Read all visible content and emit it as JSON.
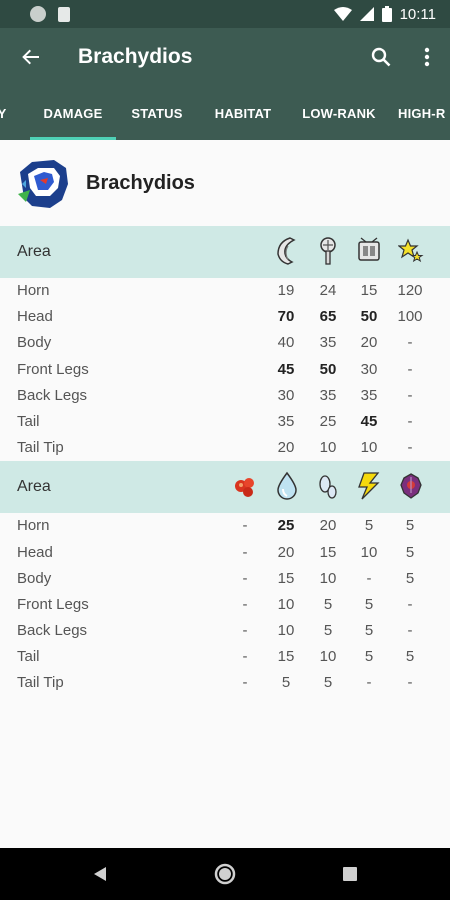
{
  "status_bar": {
    "time": "10:11"
  },
  "app_bar": {
    "title": "Brachydios"
  },
  "tabs": [
    {
      "label": "Y",
      "active": false
    },
    {
      "label": "DAMAGE",
      "active": true
    },
    {
      "label": "STATUS",
      "active": false
    },
    {
      "label": "HABITAT",
      "active": false
    },
    {
      "label": "LOW-RANK",
      "active": false
    },
    {
      "label": "HIGH-R",
      "active": false
    }
  ],
  "monster": {
    "name": "Brachydios"
  },
  "physical": {
    "header": "Area",
    "icons": [
      "sever-icon",
      "blunt-icon",
      "shot-icon",
      "stun-icon"
    ],
    "rows": [
      {
        "area": "Horn",
        "values": [
          "19",
          "24",
          "15",
          "120"
        ],
        "bold": [
          false,
          false,
          false,
          false
        ]
      },
      {
        "area": "Head",
        "values": [
          "70",
          "65",
          "50",
          "100"
        ],
        "bold": [
          true,
          true,
          true,
          false
        ]
      },
      {
        "area": "Body",
        "values": [
          "40",
          "35",
          "20",
          "-"
        ],
        "bold": [
          false,
          false,
          false,
          false
        ]
      },
      {
        "area": "Front Legs",
        "values": [
          "45",
          "50",
          "30",
          "-"
        ],
        "bold": [
          true,
          true,
          false,
          false
        ]
      },
      {
        "area": "Back Legs",
        "values": [
          "30",
          "35",
          "35",
          "-"
        ],
        "bold": [
          false,
          false,
          false,
          false
        ]
      },
      {
        "area": "Tail",
        "values": [
          "35",
          "25",
          "45",
          "-"
        ],
        "bold": [
          false,
          false,
          true,
          false
        ]
      },
      {
        "area": "Tail Tip",
        "values": [
          "20",
          "10",
          "10",
          "-"
        ],
        "bold": [
          false,
          false,
          false,
          false
        ]
      }
    ]
  },
  "elemental": {
    "header": "Area",
    "icons": [
      "fire-icon",
      "water-icon",
      "ice-icon",
      "thunder-icon",
      "dragon-icon"
    ],
    "rows": [
      {
        "area": "Horn",
        "values": [
          "-",
          "25",
          "20",
          "5",
          "5"
        ],
        "bold": [
          false,
          true,
          false,
          false,
          false
        ]
      },
      {
        "area": "Head",
        "values": [
          "-",
          "20",
          "15",
          "10",
          "5"
        ],
        "bold": [
          false,
          false,
          false,
          false,
          false
        ]
      },
      {
        "area": "Body",
        "values": [
          "-",
          "15",
          "10",
          "-",
          "5"
        ],
        "bold": [
          false,
          false,
          false,
          false,
          false
        ]
      },
      {
        "area": "Front Legs",
        "values": [
          "-",
          "10",
          "5",
          "5",
          "-"
        ],
        "bold": [
          false,
          false,
          false,
          false,
          false
        ]
      },
      {
        "area": "Back Legs",
        "values": [
          "-",
          "10",
          "5",
          "5",
          "-"
        ],
        "bold": [
          false,
          false,
          false,
          false,
          false
        ]
      },
      {
        "area": "Tail",
        "values": [
          "-",
          "15",
          "10",
          "5",
          "5"
        ],
        "bold": [
          false,
          false,
          false,
          false,
          false
        ]
      },
      {
        "area": "Tail Tip",
        "values": [
          "-",
          "5",
          "5",
          "-",
          "-"
        ],
        "bold": [
          false,
          false,
          false,
          false,
          false
        ]
      }
    ]
  },
  "colors": {
    "status_bar": "#2f4a42",
    "app_bar": "#3d5b52",
    "tab_indicator": "#4fd1b6",
    "section_header": "#cfe9e5"
  }
}
